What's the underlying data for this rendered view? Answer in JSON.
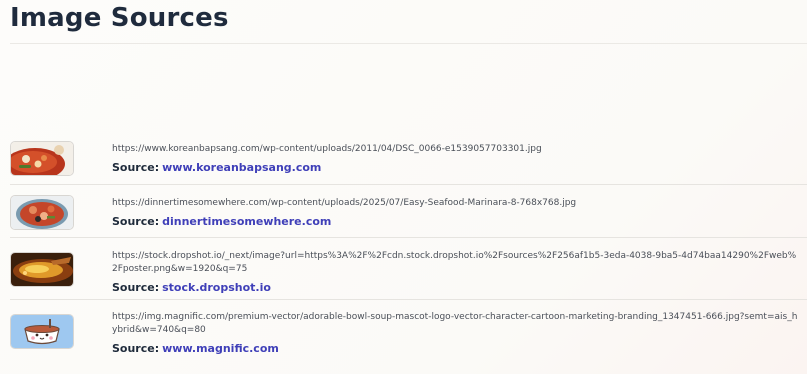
{
  "page": {
    "title": "Image Sources"
  },
  "sources": [
    {
      "url": "https://www.koreanbapsang.com/wp-content/uploads/2011/04/DSC_0066-e1539057703301.jpg",
      "source_label": "Source:",
      "source_name": "www.koreanbapsang.com",
      "thumbnail": "spicy-seafood-stew-photo"
    },
    {
      "url": "https://dinnertimesomewhere.com/wp-content/uploads/2025/07/Easy-Seafood-Marinara-8-768x768.jpg",
      "source_label": "Source:",
      "source_name": "dinnertimesomewhere.com",
      "thumbnail": "seafood-marinara-photo"
    },
    {
      "url": "https://stock.dropshot.io/_next/image?url=https%3A%2F%2Fcdn.stock.dropshot.io%2Fsources%2F256af1b5-3eda-4038-9ba5-4d74baa14290%2Fweb%2Fposter.png&w=1920&q=75",
      "source_label": "Source:",
      "source_name": "stock.dropshot.io",
      "thumbnail": "golden-soup-bowl-photo"
    },
    {
      "url": "https://img.magnific.com/premium-vector/adorable-bowl-soup-mascot-logo-vector-character-cartoon-marketing-branding_1347451-666.jpg?semt=ais_hybrid&w=740&q=80",
      "source_label": "Source:",
      "source_name": "www.magnific.com",
      "thumbnail": "cartoon-soup-bowl-mascot"
    }
  ]
}
